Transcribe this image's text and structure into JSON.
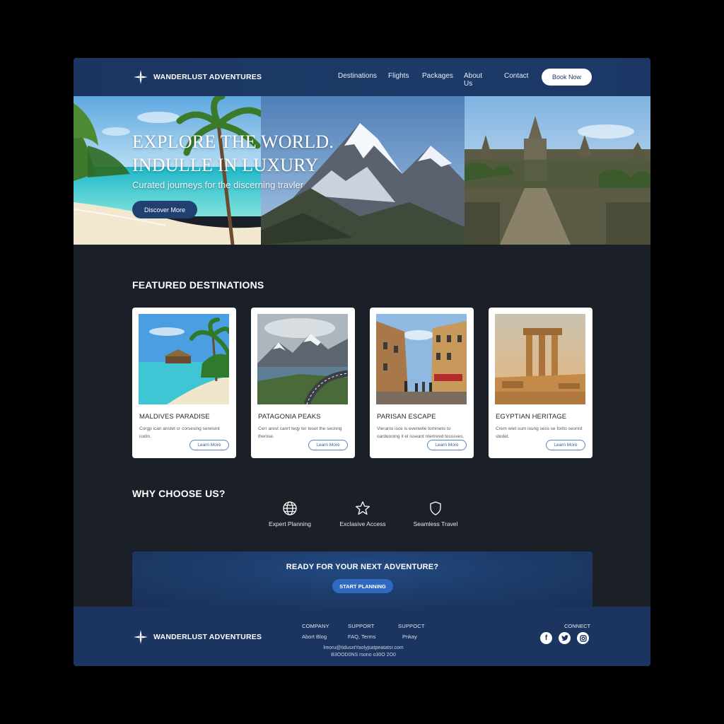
{
  "header": {
    "brand": "WANDERLUST ADVENTURES",
    "nav": [
      "Destinations",
      "Flights",
      "Packages",
      "About Us",
      "Contact"
    ],
    "book_label": "Book Now"
  },
  "hero": {
    "title_line1": "EXPLORE THE WORLD.",
    "title_line2": "INDULLE IN LUXURY",
    "subtitle": "Curated journeys for the discerning travler",
    "button": "Discover More"
  },
  "featured": {
    "title": "FEATURED DESTINATIONS",
    "cards": [
      {
        "title": "MALDIVES PARADISE",
        "desc": "Corgp ican anstet cr corsesing sereisint icetin.",
        "button": "Learn More"
      },
      {
        "title": "PATAGONIA PEAKS",
        "desc": "Cerr arest canrt teqy ter teset the seonng thenise.",
        "button": "Learn More"
      },
      {
        "title": "PARISAN ESCAPE",
        "desc": "Vierarisi isce is evenwile tomineto to oardeoning it el isseant nterinred tesssves.",
        "button": "Learn More"
      },
      {
        "title": "EGYPTIAN HERITAGE",
        "desc": "Crem wiet sum isung sess se forito seonrd stedet.",
        "button": "Learn More"
      }
    ]
  },
  "why": {
    "title": "WHY CHOOSE US?",
    "items": [
      {
        "label": "Expert Planning",
        "icon": "globe-icon"
      },
      {
        "label": "Exclasive Access",
        "icon": "star-icon"
      },
      {
        "label": "Seamless Travel",
        "icon": "shield-icon"
      }
    ]
  },
  "cta": {
    "title": "READY FOR YOUR NEXT ADVENTURE?",
    "button": "START PLANNING"
  },
  "footer": {
    "brand": "WANDERLUST ADVENTURES",
    "columns": [
      {
        "heading": "COMPANY",
        "links": "Abort Blog"
      },
      {
        "heading": "SUPPORT",
        "links": "FAQ, Terms"
      },
      {
        "heading": "SUPPOCT",
        "links": "Pnkay"
      }
    ],
    "small_line1": "lreoru@tidusxtYaolyjsatpeatatsr.com",
    "small_line2": "B3OOD0NS rsono o30O 2O0",
    "connect": "CONNECT",
    "social": [
      "facebook-icon",
      "twitter-icon",
      "instagram-icon"
    ]
  },
  "colors": {
    "header_bg": "#1d3a68",
    "page_bg": "#1b1f27",
    "accent": "#2f6ac0"
  }
}
